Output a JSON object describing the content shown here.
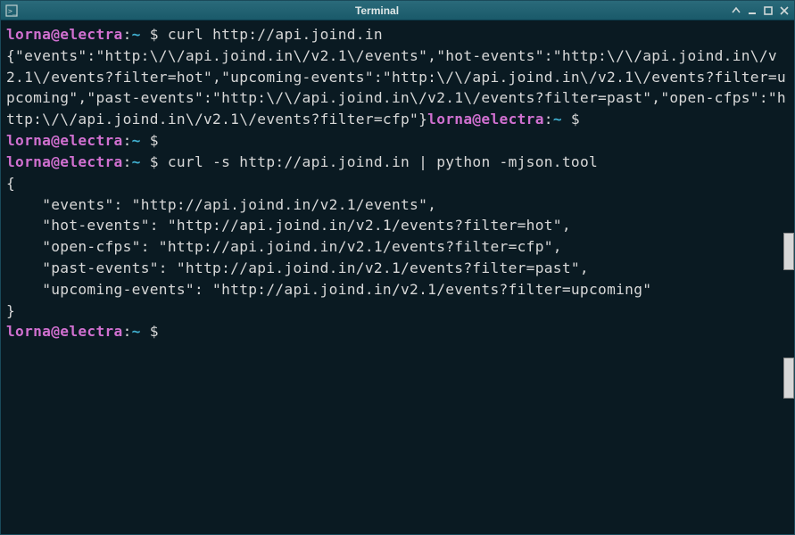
{
  "window": {
    "title": "Terminal"
  },
  "prompt": {
    "user_host": "lorna@electra",
    "path": "~",
    "symbol": "$"
  },
  "lines": {
    "cmd1": "curl http://api.joind.in",
    "out1": "{\"events\":\"http:\\/\\/api.joind.in\\/v2.1\\/events\",\"hot-events\":\"http:\\/\\/api.joind.in\\/v2.1\\/events?filter=hot\",\"upcoming-events\":\"http:\\/\\/api.joind.in\\/v2.1\\/events?filter=upcoming\",\"past-events\":\"http:\\/\\/api.joind.in\\/v2.1\\/events?filter=past\",\"open-cfps\":\"http:\\/\\/api.joind.in\\/v2.1\\/events?filter=cfp\"}",
    "cmd2": "curl -s http://api.joind.in | python -mjson.tool",
    "out2_open": "{",
    "out2_l1": "    \"events\": \"http://api.joind.in/v2.1/events\",",
    "out2_l2": "    \"hot-events\": \"http://api.joind.in/v2.1/events?filter=hot\",",
    "out2_l3": "    \"open-cfps\": \"http://api.joind.in/v2.1/events?filter=cfp\",",
    "out2_l4": "    \"past-events\": \"http://api.joind.in/v2.1/events?filter=past\",",
    "out2_l5": "    \"upcoming-events\": \"http://api.joind.in/v2.1/events?filter=upcoming\"",
    "out2_close": "}"
  }
}
